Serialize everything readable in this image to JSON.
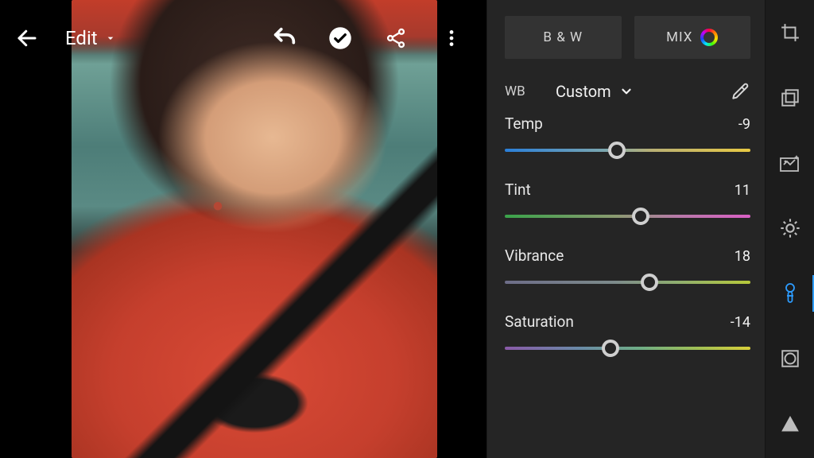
{
  "header": {
    "edit_label": "Edit"
  },
  "tabs": {
    "bw_label": "B & W",
    "mix_label": "MIX"
  },
  "wb": {
    "label": "WB",
    "preset": "Custom"
  },
  "sliders": {
    "temp": {
      "label": "Temp",
      "value": -9,
      "min": -100,
      "max": 100
    },
    "tint": {
      "label": "Tint",
      "value": 11,
      "min": -100,
      "max": 100
    },
    "vibrance": {
      "label": "Vibrance",
      "value": 18,
      "min": -100,
      "max": 100
    },
    "saturation": {
      "label": "Saturation",
      "value": -14,
      "min": -100,
      "max": 100
    }
  },
  "rail": {
    "tools": [
      "crop",
      "presets",
      "auto",
      "light",
      "color",
      "effects",
      "detail"
    ],
    "active": "color"
  }
}
